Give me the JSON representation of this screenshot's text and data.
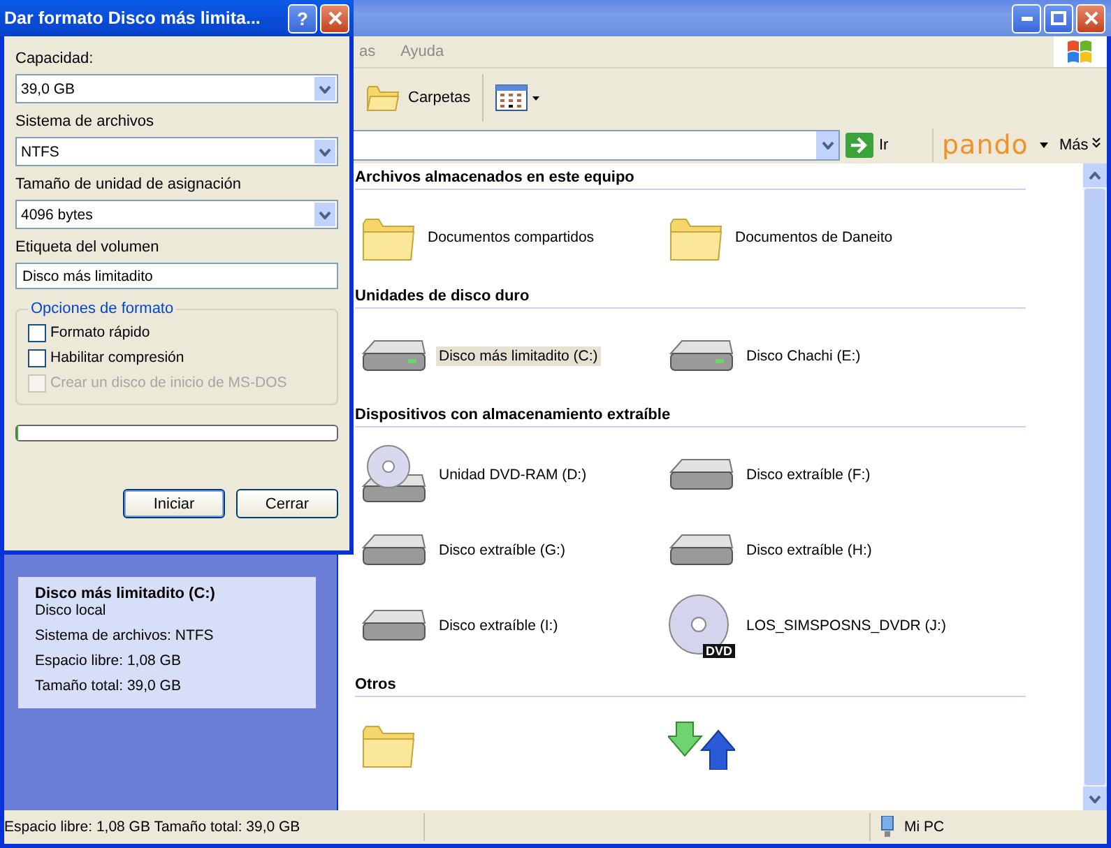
{
  "explorer": {
    "menu": [
      "as",
      "Ayuda"
    ],
    "toolbar": {
      "folders_button": "Carpetas"
    },
    "address_bar": {
      "go_button": "Ir",
      "toolbar_logo": "pando",
      "more_button": "Más"
    },
    "details": {
      "title": "Disco más limitadito (C:)",
      "lines": [
        "Disco local",
        "Sistema de archivos: NTFS",
        "Espacio libre: 1,08 GB",
        "Tamaño total: 39,0 GB"
      ]
    },
    "sections": [
      {
        "heading": "Archivos almacenados en este equipo",
        "items": [
          {
            "kind": "folder",
            "label": "Documentos compartidos",
            "selected": false
          },
          {
            "kind": "folder",
            "label": "Documentos de Daneito",
            "selected": false
          }
        ]
      },
      {
        "heading": "Unidades de disco duro",
        "items": [
          {
            "kind": "drive",
            "label": "Disco más limitadito (C:)",
            "selected": true
          },
          {
            "kind": "drive",
            "label": "Disco Chachi (E:)",
            "selected": false
          }
        ]
      },
      {
        "heading": "Dispositivos con almacenamiento extraíble",
        "items": [
          {
            "kind": "dvd-drive",
            "label": "Unidad DVD-RAM (D:)",
            "selected": false
          },
          {
            "kind": "removable",
            "label": "Disco extraíble (F:)",
            "selected": false
          },
          {
            "kind": "removable",
            "label": "Disco extraíble (G:)",
            "selected": false
          },
          {
            "kind": "removable",
            "label": "Disco extraíble (H:)",
            "selected": false
          },
          {
            "kind": "removable",
            "label": "Disco extraíble (I:)",
            "selected": false
          },
          {
            "kind": "dvd-disc",
            "badge": "DVD",
            "label": "LOS_SIMSPOSNS_DVDR (J:)",
            "selected": false
          }
        ]
      },
      {
        "heading": "Otros",
        "items": [
          {
            "kind": "folder"
          },
          {
            "kind": "sync"
          }
        ]
      }
    ],
    "status_bar": {
      "text": "Espacio libre: 1,08 GB Tamaño total: 39,0 GB",
      "location": "Mi PC"
    }
  },
  "dialog": {
    "title": "Dar formato Disco más limita...",
    "help_button": "?",
    "fields": [
      {
        "kind": "dropdown",
        "label": "Capacidad:",
        "value": "39,0 GB"
      },
      {
        "kind": "dropdown",
        "label": "Sistema de archivos",
        "value": "NTFS"
      },
      {
        "kind": "dropdown",
        "label": "Tamaño de unidad de asignación",
        "value": "4096 bytes"
      },
      {
        "kind": "text",
        "label": "Etiqueta del volumen",
        "value": "Disco más limitadito"
      }
    ],
    "options": {
      "title": "Opciones de formato",
      "checkboxes": [
        {
          "label": "Formato rápido",
          "checked": false,
          "disabled": false
        },
        {
          "label": "Habilitar compresión",
          "checked": false,
          "disabled": false
        },
        {
          "label": "Crear un disco de inicio de MS-DOS",
          "checked": false,
          "disabled": true
        }
      ]
    },
    "progress": {
      "level": 0
    },
    "buttons": [
      "Iniciar",
      "Cerrar"
    ]
  }
}
